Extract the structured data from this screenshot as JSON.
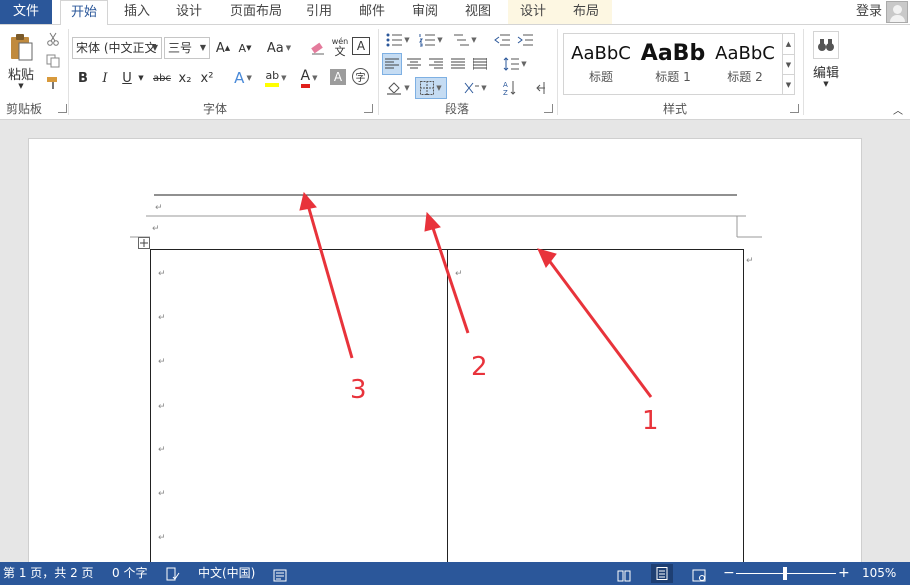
{
  "tabs": [
    {
      "label": "文件"
    },
    {
      "label": "开始"
    },
    {
      "label": "插入"
    },
    {
      "label": "设计"
    },
    {
      "label": "页面布局"
    },
    {
      "label": "引用"
    },
    {
      "label": "邮件"
    },
    {
      "label": "审阅"
    },
    {
      "label": "视图"
    },
    {
      "label": "设计"
    },
    {
      "label": "布局"
    }
  ],
  "login": "登录",
  "ribbon": {
    "clipboard": {
      "paste_label": "粘贴",
      "group_label": "剪贴板"
    },
    "font": {
      "font_name": "宋体 (中文正文",
      "font_size": "三号",
      "change_case": "Aa",
      "phonetic_top": "wén",
      "phonetic_bottom": "文",
      "char_border": "A",
      "bold": "B",
      "italic": "I",
      "underline": "U",
      "strike": "abc",
      "subscript": "x₂",
      "superscript": "x²",
      "text_effect": "A",
      "highlight": "ab",
      "font_color": "A",
      "char_shading": "A",
      "enclose": "字",
      "group_label": "字体"
    },
    "paragraph": {
      "group_label": "段落"
    },
    "styles": {
      "items": [
        {
          "preview": "AaBbC",
          "name": "标题"
        },
        {
          "preview": "AaBb",
          "name": "标题 1"
        },
        {
          "preview": "AaBbC",
          "name": "标题 2"
        }
      ],
      "group_label": "样式"
    },
    "editing": {
      "label": "编辑"
    }
  },
  "annotations": [
    "1",
    "2",
    "3"
  ],
  "status": {
    "page": "第 1 页，共 2 页",
    "words": "0 个字",
    "language": "中文(中国)",
    "zoom": "105%"
  },
  "colors": {
    "brand": "#2b579a",
    "arrow": "#e8333b",
    "highlight": "#ffff00",
    "font_color": "#e0201b"
  }
}
